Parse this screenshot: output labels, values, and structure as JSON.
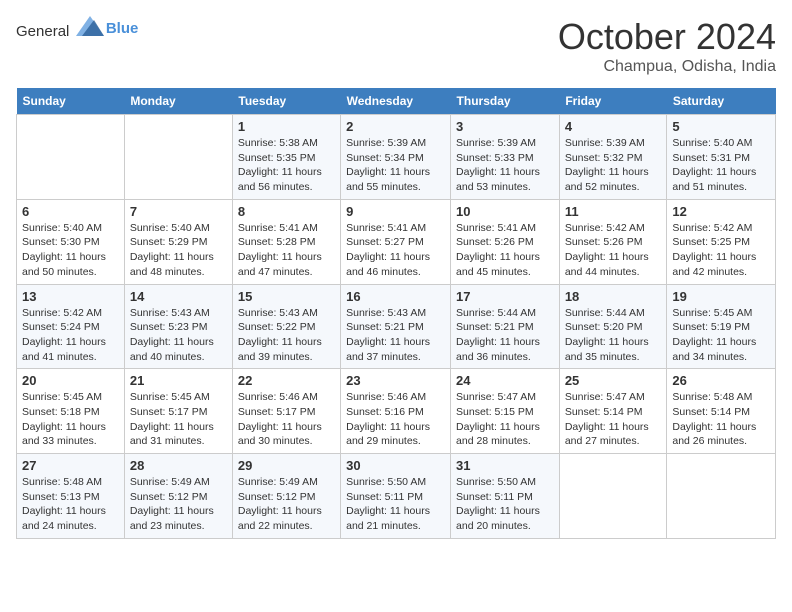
{
  "header": {
    "logo_general": "General",
    "logo_blue": "Blue",
    "month_title": "October 2024",
    "location": "Champua, Odisha, India"
  },
  "days_of_week": [
    "Sunday",
    "Monday",
    "Tuesday",
    "Wednesday",
    "Thursday",
    "Friday",
    "Saturday"
  ],
  "weeks": [
    [
      {
        "num": "",
        "sunrise": "",
        "sunset": "",
        "daylight": ""
      },
      {
        "num": "",
        "sunrise": "",
        "sunset": "",
        "daylight": ""
      },
      {
        "num": "1",
        "sunrise": "Sunrise: 5:38 AM",
        "sunset": "Sunset: 5:35 PM",
        "daylight": "Daylight: 11 hours and 56 minutes."
      },
      {
        "num": "2",
        "sunrise": "Sunrise: 5:39 AM",
        "sunset": "Sunset: 5:34 PM",
        "daylight": "Daylight: 11 hours and 55 minutes."
      },
      {
        "num": "3",
        "sunrise": "Sunrise: 5:39 AM",
        "sunset": "Sunset: 5:33 PM",
        "daylight": "Daylight: 11 hours and 53 minutes."
      },
      {
        "num": "4",
        "sunrise": "Sunrise: 5:39 AM",
        "sunset": "Sunset: 5:32 PM",
        "daylight": "Daylight: 11 hours and 52 minutes."
      },
      {
        "num": "5",
        "sunrise": "Sunrise: 5:40 AM",
        "sunset": "Sunset: 5:31 PM",
        "daylight": "Daylight: 11 hours and 51 minutes."
      }
    ],
    [
      {
        "num": "6",
        "sunrise": "Sunrise: 5:40 AM",
        "sunset": "Sunset: 5:30 PM",
        "daylight": "Daylight: 11 hours and 50 minutes."
      },
      {
        "num": "7",
        "sunrise": "Sunrise: 5:40 AM",
        "sunset": "Sunset: 5:29 PM",
        "daylight": "Daylight: 11 hours and 48 minutes."
      },
      {
        "num": "8",
        "sunrise": "Sunrise: 5:41 AM",
        "sunset": "Sunset: 5:28 PM",
        "daylight": "Daylight: 11 hours and 47 minutes."
      },
      {
        "num": "9",
        "sunrise": "Sunrise: 5:41 AM",
        "sunset": "Sunset: 5:27 PM",
        "daylight": "Daylight: 11 hours and 46 minutes."
      },
      {
        "num": "10",
        "sunrise": "Sunrise: 5:41 AM",
        "sunset": "Sunset: 5:26 PM",
        "daylight": "Daylight: 11 hours and 45 minutes."
      },
      {
        "num": "11",
        "sunrise": "Sunrise: 5:42 AM",
        "sunset": "Sunset: 5:26 PM",
        "daylight": "Daylight: 11 hours and 44 minutes."
      },
      {
        "num": "12",
        "sunrise": "Sunrise: 5:42 AM",
        "sunset": "Sunset: 5:25 PM",
        "daylight": "Daylight: 11 hours and 42 minutes."
      }
    ],
    [
      {
        "num": "13",
        "sunrise": "Sunrise: 5:42 AM",
        "sunset": "Sunset: 5:24 PM",
        "daylight": "Daylight: 11 hours and 41 minutes."
      },
      {
        "num": "14",
        "sunrise": "Sunrise: 5:43 AM",
        "sunset": "Sunset: 5:23 PM",
        "daylight": "Daylight: 11 hours and 40 minutes."
      },
      {
        "num": "15",
        "sunrise": "Sunrise: 5:43 AM",
        "sunset": "Sunset: 5:22 PM",
        "daylight": "Daylight: 11 hours and 39 minutes."
      },
      {
        "num": "16",
        "sunrise": "Sunrise: 5:43 AM",
        "sunset": "Sunset: 5:21 PM",
        "daylight": "Daylight: 11 hours and 37 minutes."
      },
      {
        "num": "17",
        "sunrise": "Sunrise: 5:44 AM",
        "sunset": "Sunset: 5:21 PM",
        "daylight": "Daylight: 11 hours and 36 minutes."
      },
      {
        "num": "18",
        "sunrise": "Sunrise: 5:44 AM",
        "sunset": "Sunset: 5:20 PM",
        "daylight": "Daylight: 11 hours and 35 minutes."
      },
      {
        "num": "19",
        "sunrise": "Sunrise: 5:45 AM",
        "sunset": "Sunset: 5:19 PM",
        "daylight": "Daylight: 11 hours and 34 minutes."
      }
    ],
    [
      {
        "num": "20",
        "sunrise": "Sunrise: 5:45 AM",
        "sunset": "Sunset: 5:18 PM",
        "daylight": "Daylight: 11 hours and 33 minutes."
      },
      {
        "num": "21",
        "sunrise": "Sunrise: 5:45 AM",
        "sunset": "Sunset: 5:17 PM",
        "daylight": "Daylight: 11 hours and 31 minutes."
      },
      {
        "num": "22",
        "sunrise": "Sunrise: 5:46 AM",
        "sunset": "Sunset: 5:17 PM",
        "daylight": "Daylight: 11 hours and 30 minutes."
      },
      {
        "num": "23",
        "sunrise": "Sunrise: 5:46 AM",
        "sunset": "Sunset: 5:16 PM",
        "daylight": "Daylight: 11 hours and 29 minutes."
      },
      {
        "num": "24",
        "sunrise": "Sunrise: 5:47 AM",
        "sunset": "Sunset: 5:15 PM",
        "daylight": "Daylight: 11 hours and 28 minutes."
      },
      {
        "num": "25",
        "sunrise": "Sunrise: 5:47 AM",
        "sunset": "Sunset: 5:14 PM",
        "daylight": "Daylight: 11 hours and 27 minutes."
      },
      {
        "num": "26",
        "sunrise": "Sunrise: 5:48 AM",
        "sunset": "Sunset: 5:14 PM",
        "daylight": "Daylight: 11 hours and 26 minutes."
      }
    ],
    [
      {
        "num": "27",
        "sunrise": "Sunrise: 5:48 AM",
        "sunset": "Sunset: 5:13 PM",
        "daylight": "Daylight: 11 hours and 24 minutes."
      },
      {
        "num": "28",
        "sunrise": "Sunrise: 5:49 AM",
        "sunset": "Sunset: 5:12 PM",
        "daylight": "Daylight: 11 hours and 23 minutes."
      },
      {
        "num": "29",
        "sunrise": "Sunrise: 5:49 AM",
        "sunset": "Sunset: 5:12 PM",
        "daylight": "Daylight: 11 hours and 22 minutes."
      },
      {
        "num": "30",
        "sunrise": "Sunrise: 5:50 AM",
        "sunset": "Sunset: 5:11 PM",
        "daylight": "Daylight: 11 hours and 21 minutes."
      },
      {
        "num": "31",
        "sunrise": "Sunrise: 5:50 AM",
        "sunset": "Sunset: 5:11 PM",
        "daylight": "Daylight: 11 hours and 20 minutes."
      },
      {
        "num": "",
        "sunrise": "",
        "sunset": "",
        "daylight": ""
      },
      {
        "num": "",
        "sunrise": "",
        "sunset": "",
        "daylight": ""
      }
    ]
  ]
}
